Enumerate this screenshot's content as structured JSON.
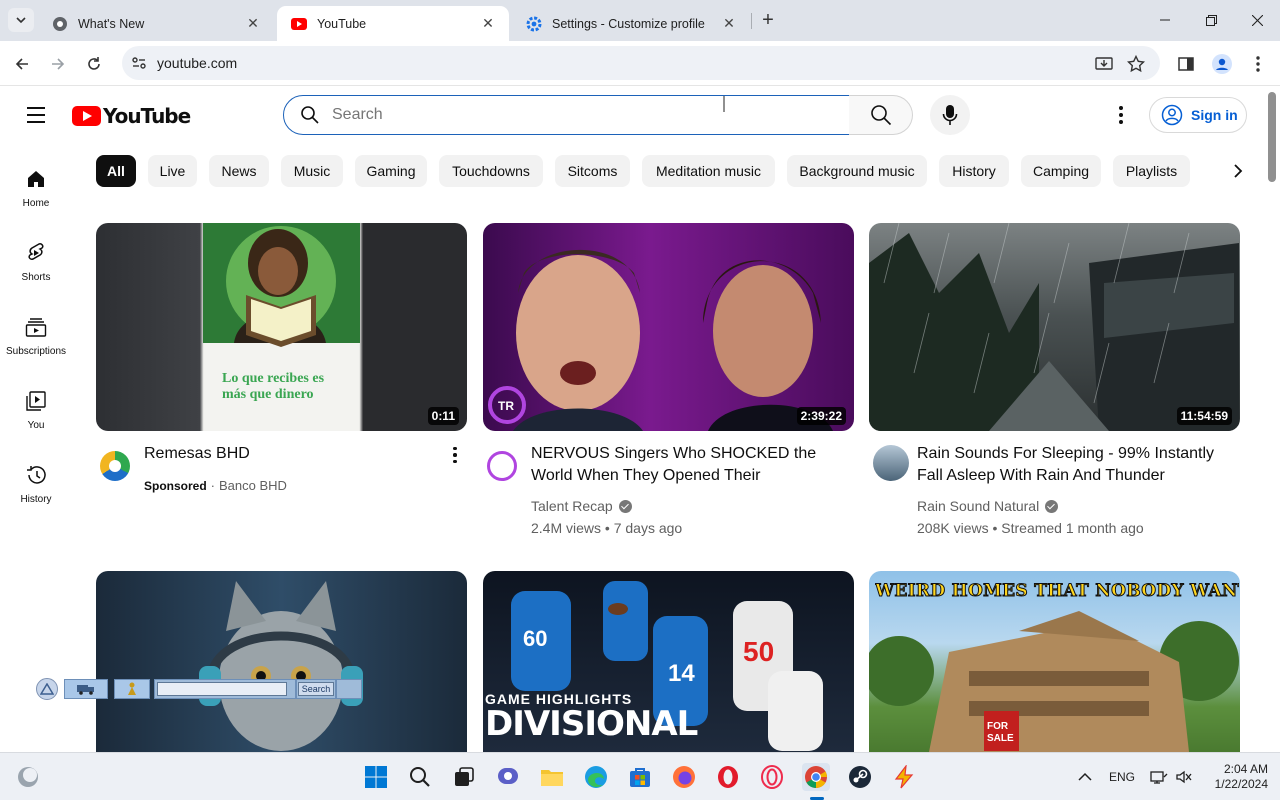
{
  "browser": {
    "tabs": [
      {
        "title": "What's New"
      },
      {
        "title": "YouTube"
      },
      {
        "title": "Settings - Customize profile"
      }
    ],
    "address": "youtube.com"
  },
  "youtube": {
    "logo_text": "YouTube",
    "search_placeholder": "Search",
    "sign_in": "Sign in",
    "guide": [
      {
        "label": "Home",
        "icon": "home-icon"
      },
      {
        "label": "Shorts",
        "icon": "shorts-icon"
      },
      {
        "label": "Subscriptions",
        "icon": "subscriptions-icon"
      },
      {
        "label": "You",
        "icon": "you-icon"
      },
      {
        "label": "History",
        "icon": "history-icon"
      }
    ],
    "chips": [
      "All",
      "Live",
      "News",
      "Music",
      "Gaming",
      "Touchdowns",
      "Sitcoms",
      "Meditation music",
      "Background music",
      "History",
      "Camping",
      "Playlists"
    ],
    "videos": [
      {
        "title": "Remesas BHD",
        "sponsored": "Sponsored",
        "channel": "Banco BHD",
        "duration": "0:11",
        "thumb_text_1": "Lo que recibes es",
        "thumb_text_2": "más que dinero"
      },
      {
        "title": "NERVOUS Singers Who SHOCKED the World When They Opened Their Mouths!...",
        "channel": "Talent Recap",
        "stats": "2.4M views • 7 days ago",
        "duration": "2:39:22"
      },
      {
        "title": "Rain Sounds For Sleeping - 99% Instantly Fall Asleep With Rain And Thunder Soun...",
        "channel": "Rain Sound Natural",
        "stats": "208K views • Streamed 1 month ago",
        "duration": "11:54:59"
      },
      {
        "title": "",
        "channel": ""
      },
      {
        "title": "",
        "thumb_text_1": "GAME HIGHLIGHTS",
        "thumb_text_2": "DIVISIONAL"
      },
      {
        "title": "",
        "thumb_text_1": "WEIRD HOMES THAT NOBODY WANTS"
      }
    ]
  },
  "floating_toolbar": {
    "search_label": "Search"
  },
  "taskbar": {
    "language": "ENG",
    "time": "2:04 AM",
    "date": "1/22/2024"
  },
  "colors": {
    "brand_red": "#ff0000",
    "link_blue": "#065fd4",
    "chip_active": "#0f0f0f"
  }
}
